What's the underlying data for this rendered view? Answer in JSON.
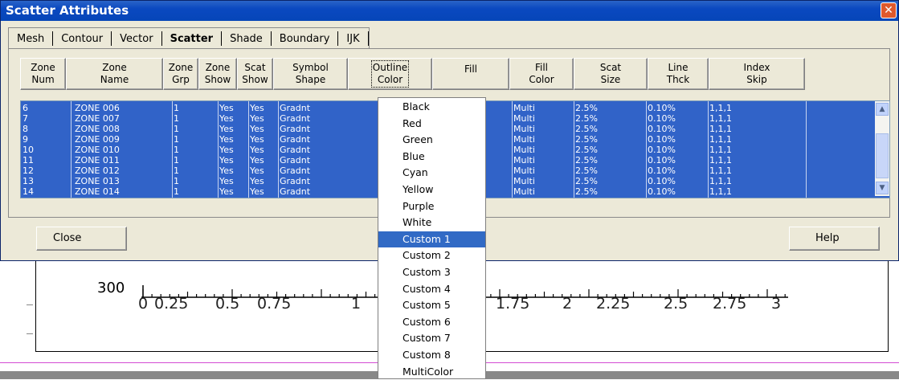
{
  "window": {
    "title": "Scatter Attributes",
    "close_glyph": "✕"
  },
  "tabs": [
    {
      "label": "Mesh",
      "active": false
    },
    {
      "label": "Contour",
      "active": false
    },
    {
      "label": "Vector",
      "active": false
    },
    {
      "label": "Scatter",
      "active": true
    },
    {
      "label": "Shade",
      "active": false
    },
    {
      "label": "Boundary",
      "active": false
    },
    {
      "label": "IJK",
      "active": false
    }
  ],
  "columns": [
    {
      "label": "Zone\nNum"
    },
    {
      "label": "Zone\nName"
    },
    {
      "label": "Zone\nGrp"
    },
    {
      "label": "Zone\nShow"
    },
    {
      "label": "Scat\nShow"
    },
    {
      "label": "Symbol\nShape"
    },
    {
      "label": "Outline\nColor"
    },
    {
      "label": "Fill"
    },
    {
      "label": "Fill\nColor"
    },
    {
      "label": "Scat\nSize"
    },
    {
      "label": "Line\nThck"
    },
    {
      "label": "Index\nSkip"
    }
  ],
  "rows": [
    [
      "6",
      "ZONE 006",
      "1",
      "Yes",
      "Yes",
      "Gradnt",
      "Multi",
      "2.5%",
      "0.10%",
      "1,1,1"
    ],
    [
      "7",
      "ZONE 007",
      "1",
      "Yes",
      "Yes",
      "Gradnt",
      "Multi",
      "2.5%",
      "0.10%",
      "1,1,1"
    ],
    [
      "8",
      "ZONE 008",
      "1",
      "Yes",
      "Yes",
      "Gradnt",
      "Multi",
      "2.5%",
      "0.10%",
      "1,1,1"
    ],
    [
      "9",
      "ZONE 009",
      "1",
      "Yes",
      "Yes",
      "Gradnt",
      "Multi",
      "2.5%",
      "0.10%",
      "1,1,1"
    ],
    [
      "10",
      "ZONE 010",
      "1",
      "Yes",
      "Yes",
      "Gradnt",
      "Multi",
      "2.5%",
      "0.10%",
      "1,1,1"
    ],
    [
      "11",
      "ZONE 011",
      "1",
      "Yes",
      "Yes",
      "Gradnt",
      "Multi",
      "2.5%",
      "0.10%",
      "1,1,1"
    ],
    [
      "12",
      "ZONE 012",
      "1",
      "Yes",
      "Yes",
      "Gradnt",
      "Multi",
      "2.5%",
      "0.10%",
      "1,1,1"
    ],
    [
      "13",
      "ZONE 013",
      "1",
      "Yes",
      "Yes",
      "Gradnt",
      "Multi",
      "2.5%",
      "0.10%",
      "1,1,1"
    ],
    [
      "14",
      "ZONE 014",
      "1",
      "Yes",
      "Yes",
      "Gradnt",
      "Multi",
      "2.5%",
      "0.10%",
      "1,1,1"
    ]
  ],
  "buttons": {
    "close": "Close",
    "help": "Help"
  },
  "dropdown": {
    "items": [
      "Black",
      "Red",
      "Green",
      "Blue",
      "Cyan",
      "Yellow",
      "Purple",
      "White",
      "Custom 1",
      "Custom 2",
      "Custom 3",
      "Custom 4",
      "Custom 5",
      "Custom 6",
      "Custom 7",
      "Custom 8",
      "MultiColor"
    ],
    "selected": "Custom 1"
  },
  "plot_axis": {
    "y_label": "300",
    "x_ticks": [
      "0",
      "0.25",
      "0.5",
      "0.75",
      "1",
      "1.75",
      "2",
      "2.25",
      "2.5",
      "2.75",
      "3"
    ]
  },
  "colors": {
    "selection": "#316ac5",
    "list_bg": "#3163c8",
    "title_bar": "#0a48c0",
    "dialog_bg": "#ece9d8"
  }
}
